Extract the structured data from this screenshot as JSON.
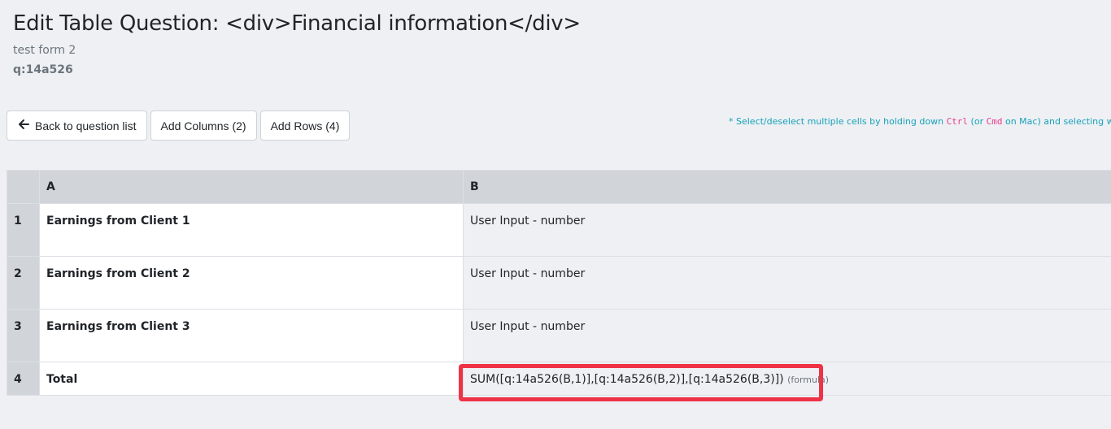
{
  "header": {
    "title": "Edit Table Question: <div>Financial information</div>",
    "form_name": "test form 2",
    "question_id": "q:14a526"
  },
  "toolbar": {
    "back_label": "Back to question list",
    "add_columns_label": "Add Columns (2)",
    "add_rows_label": "Add Rows (4)",
    "back_icon": "arrow-left-icon"
  },
  "hint": {
    "part1": "* Select/deselect multiple cells by holding down ",
    "key1": "Ctrl",
    "part2": " (or ",
    "key2": "Cmd",
    "part3": " on Mac) and selecting with"
  },
  "table": {
    "columns": [
      "A",
      "B"
    ],
    "rows": [
      {
        "num": "1",
        "label": "Earnings from Client 1",
        "value": "User Input - number"
      },
      {
        "num": "2",
        "label": "Earnings from Client 2",
        "value": "User Input - number"
      },
      {
        "num": "3",
        "label": "Earnings from Client 3",
        "value": "User Input - number"
      },
      {
        "num": "4",
        "label": "Total",
        "formula": "SUM([q:14a526(B,1)],[q:14a526(B,2)],[q:14a526(B,3)])",
        "formula_tag": "(formula)"
      }
    ]
  },
  "colors": {
    "highlight": "#ef3347",
    "hint_text": "#17a2b8",
    "code_text": "#e83e8c",
    "header_bg": "#d1d4d8",
    "page_bg": "#eef0f4"
  }
}
